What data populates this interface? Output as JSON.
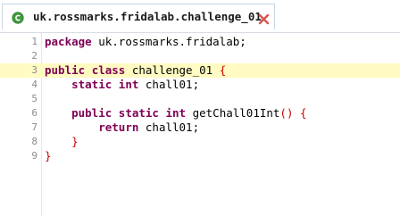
{
  "tab": {
    "title": "uk.rossmarks.fridalab.challenge_01",
    "icon": "class-icon",
    "close_icon": "close-icon"
  },
  "colors": {
    "keyword": "#7f0055",
    "bracket": "#cc0000",
    "current_line": "#fffbc2"
  },
  "lines": [
    {
      "n": "1",
      "tokens": [
        {
          "t": "package",
          "c": "kw"
        },
        {
          "t": " uk.rossmarks.fridalab;",
          "c": "txt"
        }
      ]
    },
    {
      "n": "2",
      "tokens": []
    },
    {
      "n": "3",
      "current": true,
      "tokens": [
        {
          "t": "public",
          "c": "kw"
        },
        {
          "t": " ",
          "c": "txt"
        },
        {
          "t": "class",
          "c": "kw"
        },
        {
          "t": " challenge_01 ",
          "c": "txt"
        },
        {
          "t": "{",
          "c": "br"
        }
      ]
    },
    {
      "n": "4",
      "tokens": [
        {
          "t": "    ",
          "c": "txt"
        },
        {
          "t": "static",
          "c": "kw"
        },
        {
          "t": " ",
          "c": "txt"
        },
        {
          "t": "int",
          "c": "kw"
        },
        {
          "t": " chall01;",
          "c": "txt"
        }
      ]
    },
    {
      "n": "5",
      "tokens": []
    },
    {
      "n": "6",
      "tokens": [
        {
          "t": "    ",
          "c": "txt"
        },
        {
          "t": "public",
          "c": "kw"
        },
        {
          "t": " ",
          "c": "txt"
        },
        {
          "t": "static",
          "c": "kw"
        },
        {
          "t": " ",
          "c": "txt"
        },
        {
          "t": "int",
          "c": "kw"
        },
        {
          "t": " getChall01Int",
          "c": "txt"
        },
        {
          "t": "()",
          "c": "br"
        },
        {
          "t": " ",
          "c": "txt"
        },
        {
          "t": "{",
          "c": "br"
        }
      ]
    },
    {
      "n": "7",
      "tokens": [
        {
          "t": "        ",
          "c": "txt"
        },
        {
          "t": "return",
          "c": "kw"
        },
        {
          "t": " chall01;",
          "c": "txt"
        }
      ]
    },
    {
      "n": "8",
      "tokens": [
        {
          "t": "    ",
          "c": "txt"
        },
        {
          "t": "}",
          "c": "br"
        }
      ]
    },
    {
      "n": "9",
      "tokens": [
        {
          "t": "}",
          "c": "br"
        }
      ]
    }
  ]
}
